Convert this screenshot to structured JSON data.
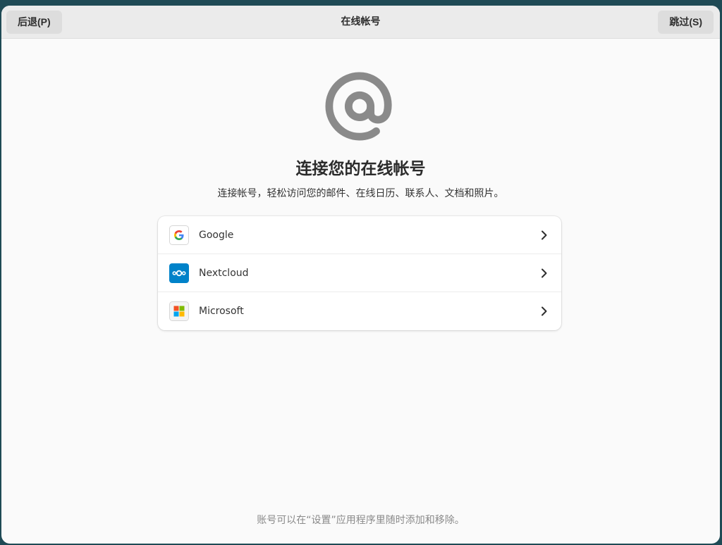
{
  "header": {
    "back_label": "后退(P)",
    "title": "在线帐号",
    "skip_label": "跳过(S)"
  },
  "main": {
    "icon": "at-sign-icon",
    "heading": "连接您的在线帐号",
    "subtitle": "连接帐号，轻松访问您的邮件、在线日历、联系人、文档和照片。",
    "providers": [
      {
        "label": "Google",
        "icon": "google-icon"
      },
      {
        "label": "Nextcloud",
        "icon": "nextcloud-icon"
      },
      {
        "label": "Microsoft",
        "icon": "microsoft-icon"
      }
    ],
    "footnote": "账号可以在“设置”应用程序里随时添加和移除。"
  },
  "colors": {
    "nextcloud_blue": "#0082c9",
    "hero_icon_gray": "#8a8a8a"
  }
}
